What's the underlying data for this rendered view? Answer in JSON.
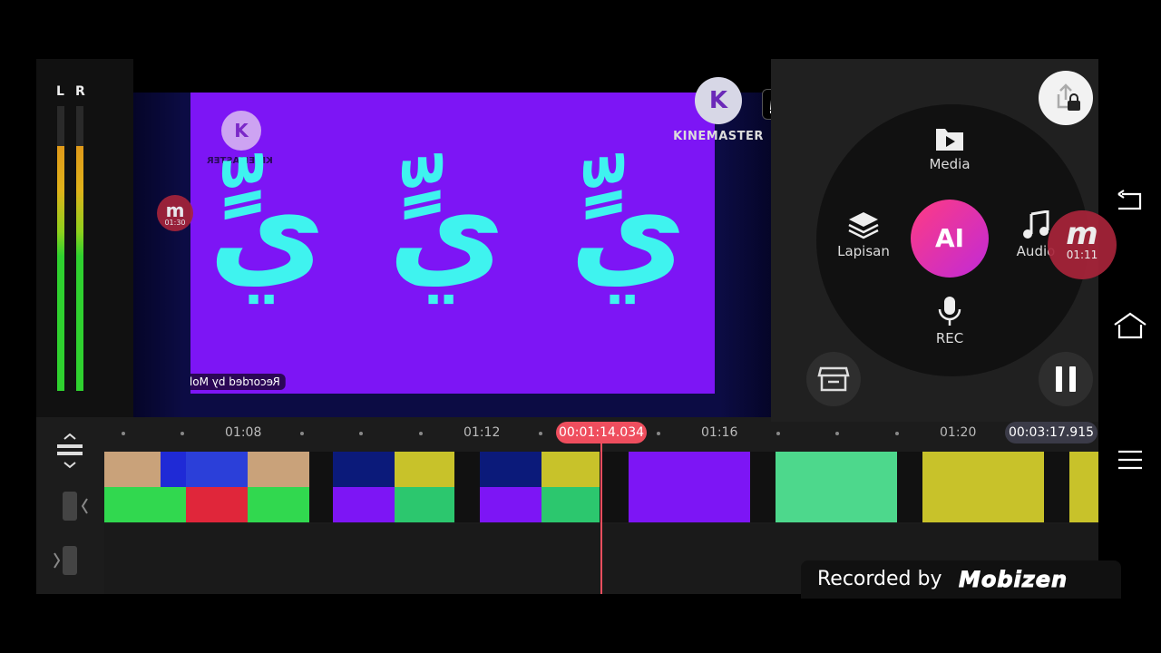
{
  "meter": {
    "left_label": "L",
    "right_label": "R",
    "left_level": 0.86,
    "right_level": 0.86
  },
  "preview": {
    "glyphs": [
      "يٍّ",
      "يٍّ",
      "يٍّ"
    ],
    "mini_kinemaster_label": "KINEMASTER",
    "mini_recorded_label": "Recorded by Mobizen",
    "mini_badge_time": "01:30"
  },
  "watermark": {
    "logo_letter": "K",
    "label": "KINEMASTER"
  },
  "menu": {
    "media_label": "Media",
    "layer_label": "Lapisan",
    "ai_label": "AI",
    "audio_label": "Audio",
    "rec_label": "REC"
  },
  "badge": {
    "letter": "m",
    "time": "01:11"
  },
  "timeline": {
    "ticks": [
      "01:08",
      "01:12",
      "01:16",
      "01:20"
    ],
    "current_time": "00:01:14.034",
    "total_time": "00:03:17.915"
  },
  "footer": {
    "recorded_label": "Recorded by",
    "brand": "Mobizen"
  },
  "colors": {
    "accent": "#ef4e5e",
    "video_bg": "#7d15f5",
    "glyph": "#3ff3ef"
  },
  "icons": [
    "crown-icon",
    "share-lock-icon",
    "media-icon",
    "layers-icon",
    "audio-icon",
    "mic-icon",
    "store-icon",
    "pause-icon",
    "back-icon",
    "home-icon",
    "menu-icon"
  ]
}
